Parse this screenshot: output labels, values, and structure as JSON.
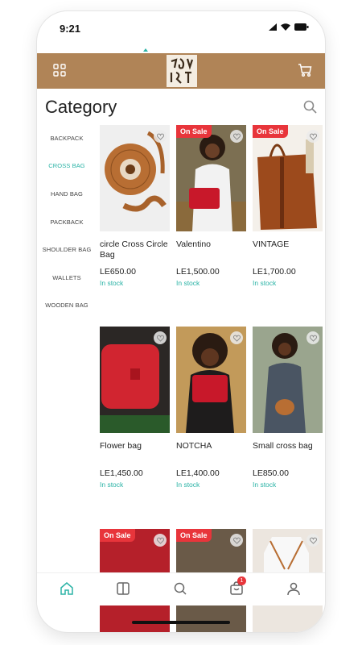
{
  "status": {
    "time": "9:21"
  },
  "header": {
    "title": "Category"
  },
  "categories": [
    "BACKPACK",
    "CROSS BAG",
    "HAND BAG",
    "PACKBACK",
    "SHOULDER BAG",
    "WALLETS",
    "WOODEN BAG"
  ],
  "active_category": "CROSS BAG",
  "products": [
    {
      "name": "circle Cross Circle Bag",
      "price": "LE650.00",
      "stock": "In stock",
      "badge": ""
    },
    {
      "name": "Valentino",
      "price": "LE1,500.00",
      "stock": "In stock",
      "badge": "On Sale"
    },
    {
      "name": "VINTAGE",
      "price": "LE1,700.00",
      "stock": "In stock",
      "badge": "On Sale"
    },
    {
      "name": "Flower bag",
      "price": "LE1,450.00",
      "stock": "In stock",
      "badge": ""
    },
    {
      "name": "NOTCHA",
      "price": "LE1,400.00",
      "stock": "In stock",
      "badge": ""
    },
    {
      "name": "Small cross bag",
      "price": "LE850.00",
      "stock": "In stock",
      "badge": ""
    },
    {
      "badge": "On Sale"
    },
    {
      "badge": "On Sale"
    },
    {
      "badge": ""
    }
  ],
  "bottom_nav": {
    "cart_count": "1"
  },
  "colors": {
    "brand": "#b08457",
    "accent": "#2bb3a6",
    "sale": "#e8353b"
  }
}
